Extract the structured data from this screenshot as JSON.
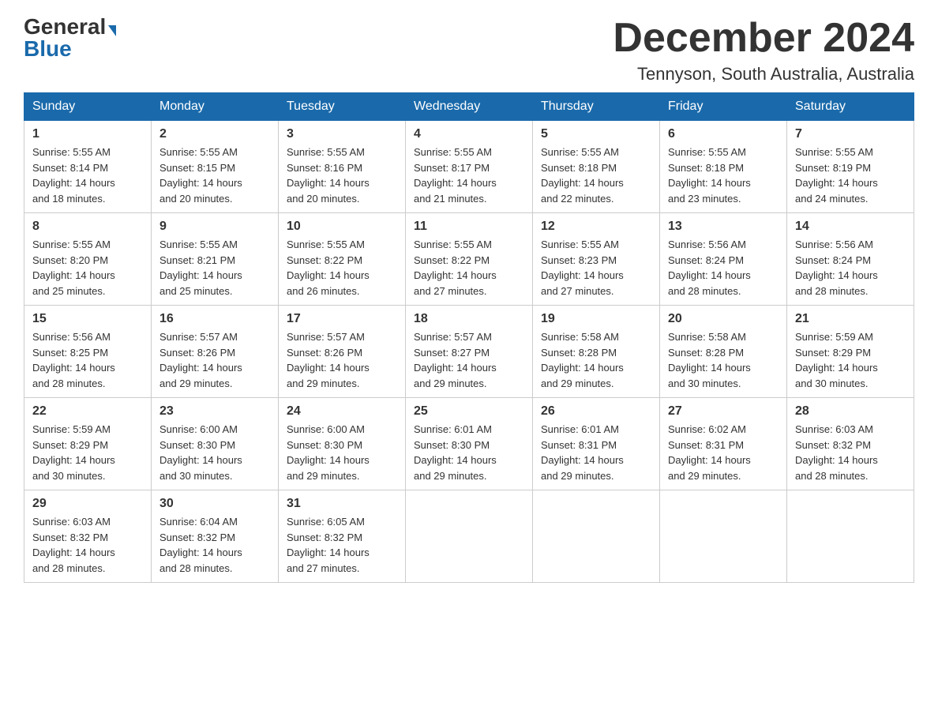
{
  "header": {
    "logo_general": "General",
    "logo_blue": "Blue",
    "month_year": "December 2024",
    "location": "Tennyson, South Australia, Australia"
  },
  "days_of_week": [
    "Sunday",
    "Monday",
    "Tuesday",
    "Wednesday",
    "Thursday",
    "Friday",
    "Saturday"
  ],
  "weeks": [
    [
      {
        "day": "1",
        "sunrise": "5:55 AM",
        "sunset": "8:14 PM",
        "daylight": "14 hours and 18 minutes."
      },
      {
        "day": "2",
        "sunrise": "5:55 AM",
        "sunset": "8:15 PM",
        "daylight": "14 hours and 20 minutes."
      },
      {
        "day": "3",
        "sunrise": "5:55 AM",
        "sunset": "8:16 PM",
        "daylight": "14 hours and 20 minutes."
      },
      {
        "day": "4",
        "sunrise": "5:55 AM",
        "sunset": "8:17 PM",
        "daylight": "14 hours and 21 minutes."
      },
      {
        "day": "5",
        "sunrise": "5:55 AM",
        "sunset": "8:18 PM",
        "daylight": "14 hours and 22 minutes."
      },
      {
        "day": "6",
        "sunrise": "5:55 AM",
        "sunset": "8:18 PM",
        "daylight": "14 hours and 23 minutes."
      },
      {
        "day": "7",
        "sunrise": "5:55 AM",
        "sunset": "8:19 PM",
        "daylight": "14 hours and 24 minutes."
      }
    ],
    [
      {
        "day": "8",
        "sunrise": "5:55 AM",
        "sunset": "8:20 PM",
        "daylight": "14 hours and 25 minutes."
      },
      {
        "day": "9",
        "sunrise": "5:55 AM",
        "sunset": "8:21 PM",
        "daylight": "14 hours and 25 minutes."
      },
      {
        "day": "10",
        "sunrise": "5:55 AM",
        "sunset": "8:22 PM",
        "daylight": "14 hours and 26 minutes."
      },
      {
        "day": "11",
        "sunrise": "5:55 AM",
        "sunset": "8:22 PM",
        "daylight": "14 hours and 27 minutes."
      },
      {
        "day": "12",
        "sunrise": "5:55 AM",
        "sunset": "8:23 PM",
        "daylight": "14 hours and 27 minutes."
      },
      {
        "day": "13",
        "sunrise": "5:56 AM",
        "sunset": "8:24 PM",
        "daylight": "14 hours and 28 minutes."
      },
      {
        "day": "14",
        "sunrise": "5:56 AM",
        "sunset": "8:24 PM",
        "daylight": "14 hours and 28 minutes."
      }
    ],
    [
      {
        "day": "15",
        "sunrise": "5:56 AM",
        "sunset": "8:25 PM",
        "daylight": "14 hours and 28 minutes."
      },
      {
        "day": "16",
        "sunrise": "5:57 AM",
        "sunset": "8:26 PM",
        "daylight": "14 hours and 29 minutes."
      },
      {
        "day": "17",
        "sunrise": "5:57 AM",
        "sunset": "8:26 PM",
        "daylight": "14 hours and 29 minutes."
      },
      {
        "day": "18",
        "sunrise": "5:57 AM",
        "sunset": "8:27 PM",
        "daylight": "14 hours and 29 minutes."
      },
      {
        "day": "19",
        "sunrise": "5:58 AM",
        "sunset": "8:28 PM",
        "daylight": "14 hours and 29 minutes."
      },
      {
        "day": "20",
        "sunrise": "5:58 AM",
        "sunset": "8:28 PM",
        "daylight": "14 hours and 30 minutes."
      },
      {
        "day": "21",
        "sunrise": "5:59 AM",
        "sunset": "8:29 PM",
        "daylight": "14 hours and 30 minutes."
      }
    ],
    [
      {
        "day": "22",
        "sunrise": "5:59 AM",
        "sunset": "8:29 PM",
        "daylight": "14 hours and 30 minutes."
      },
      {
        "day": "23",
        "sunrise": "6:00 AM",
        "sunset": "8:30 PM",
        "daylight": "14 hours and 30 minutes."
      },
      {
        "day": "24",
        "sunrise": "6:00 AM",
        "sunset": "8:30 PM",
        "daylight": "14 hours and 29 minutes."
      },
      {
        "day": "25",
        "sunrise": "6:01 AM",
        "sunset": "8:30 PM",
        "daylight": "14 hours and 29 minutes."
      },
      {
        "day": "26",
        "sunrise": "6:01 AM",
        "sunset": "8:31 PM",
        "daylight": "14 hours and 29 minutes."
      },
      {
        "day": "27",
        "sunrise": "6:02 AM",
        "sunset": "8:31 PM",
        "daylight": "14 hours and 29 minutes."
      },
      {
        "day": "28",
        "sunrise": "6:03 AM",
        "sunset": "8:32 PM",
        "daylight": "14 hours and 28 minutes."
      }
    ],
    [
      {
        "day": "29",
        "sunrise": "6:03 AM",
        "sunset": "8:32 PM",
        "daylight": "14 hours and 28 minutes."
      },
      {
        "day": "30",
        "sunrise": "6:04 AM",
        "sunset": "8:32 PM",
        "daylight": "14 hours and 28 minutes."
      },
      {
        "day": "31",
        "sunrise": "6:05 AM",
        "sunset": "8:32 PM",
        "daylight": "14 hours and 27 minutes."
      },
      null,
      null,
      null,
      null
    ]
  ],
  "labels": {
    "sunrise": "Sunrise:",
    "sunset": "Sunset:",
    "daylight": "Daylight:"
  }
}
